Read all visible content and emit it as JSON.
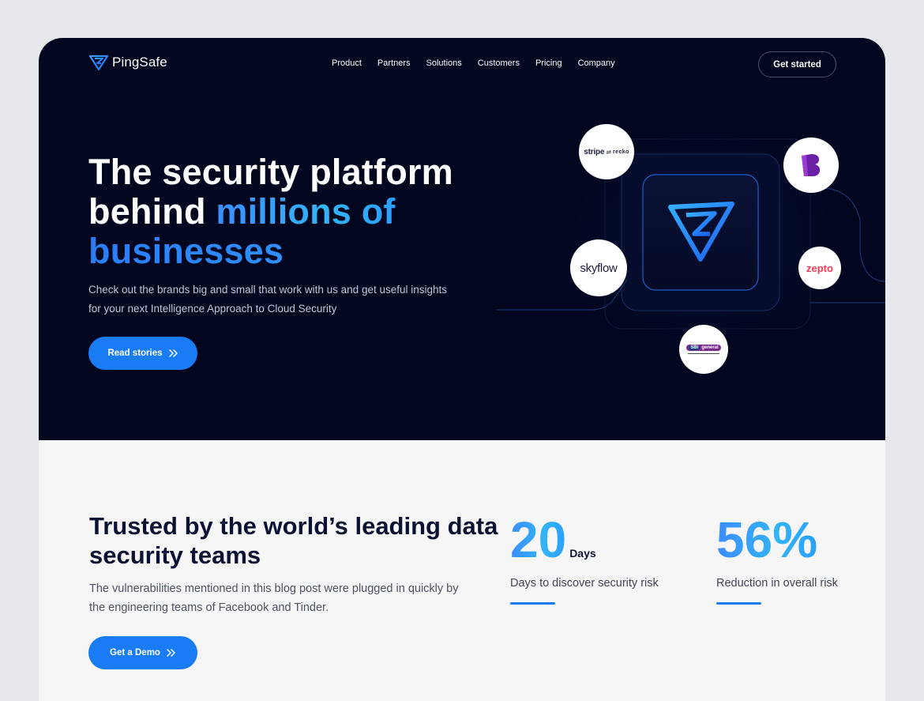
{
  "brand": {
    "name": "PingSafe"
  },
  "nav": {
    "links": [
      "Product",
      "Partners",
      "Solutions",
      "Customers",
      "Pricing",
      "Company"
    ],
    "cta": "Get started"
  },
  "hero": {
    "title_line1": "The security platform",
    "title_line2_plain": "behind ",
    "title_line2_accent": "millions of",
    "title_line3_accent": "businesses",
    "subtitle": "Check out the brands big and small that work with us and get useful insights for your next Intelligence Approach to Cloud Security",
    "button": "Read stories"
  },
  "partners": {
    "stripe": "stripe",
    "recko": "recko",
    "skyflow": "skyflow",
    "zepto": "zepto",
    "sbi_left": "SBI",
    "sbi_right": "general"
  },
  "trusted": {
    "title": "Trusted by the world’s leading data security teams",
    "subtitle": "The vulnerabilities mentioned in this blog post were plugged in quickly by the engineering teams of Facebook and Tinder.",
    "button": "Get a Demo"
  },
  "stats": [
    {
      "value": "20",
      "unit": "Days",
      "label": "Days to discover security risk"
    },
    {
      "value": "56%",
      "unit": "",
      "label": "Reduction in overall risk"
    }
  ],
  "colors": {
    "hero_bg": "#02061f",
    "accent": "#1a7cf5",
    "accent_light": "#33b4f5",
    "dark_text": "#0c1233"
  }
}
